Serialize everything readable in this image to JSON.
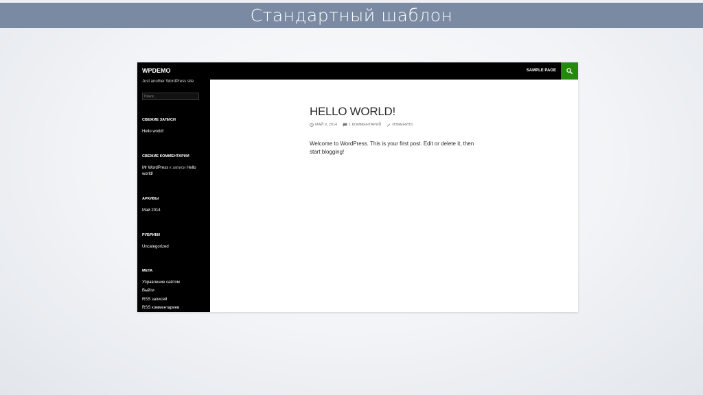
{
  "slide": {
    "title": "Стандартный шаблон"
  },
  "site": {
    "title": "WPDEMO",
    "tagline": "Just another WordPress site",
    "nav_item": "SAMPLE PAGE",
    "search_placeholder": "Поиск..."
  },
  "widgets": {
    "recent_posts_title": "СВЕЖИЕ ЗАПИСИ",
    "recent_post_1": "Hello world!",
    "recent_comments_title": "СВЕЖИЕ КОММЕНТАРИИ",
    "comment_author": "Mr WordPress",
    "comment_on": "к записи",
    "comment_post_a": "Hello",
    "comment_post_b": "world!",
    "archives_title": "АРХИВЫ",
    "archive_1": "Май 2014",
    "categories_title": "РУБРИКИ",
    "category_1": "Uncategorized",
    "meta_title": "МЕТА",
    "meta_links": [
      "Управление сайтом",
      "Выйти",
      "RSS записей",
      "RSS комментариев"
    ]
  },
  "post": {
    "title": "HELLO WORLD!",
    "date": "МАЙ 9, 2014",
    "comments": "1 КОММЕНТАРИЙ",
    "edit": "ИЗМЕНИТЬ",
    "body_line1": "Welcome to WordPress. This is your first post. Edit or delete it, then",
    "body_line2": "start blogging!"
  },
  "colors": {
    "header_band": "#7a8aa3",
    "wp_black": "#000000",
    "wp_green": "#24890d"
  },
  "icons": {
    "search": "search-icon",
    "clock": "clock-icon",
    "comment": "comment-icon",
    "pencil": "pencil-icon"
  }
}
